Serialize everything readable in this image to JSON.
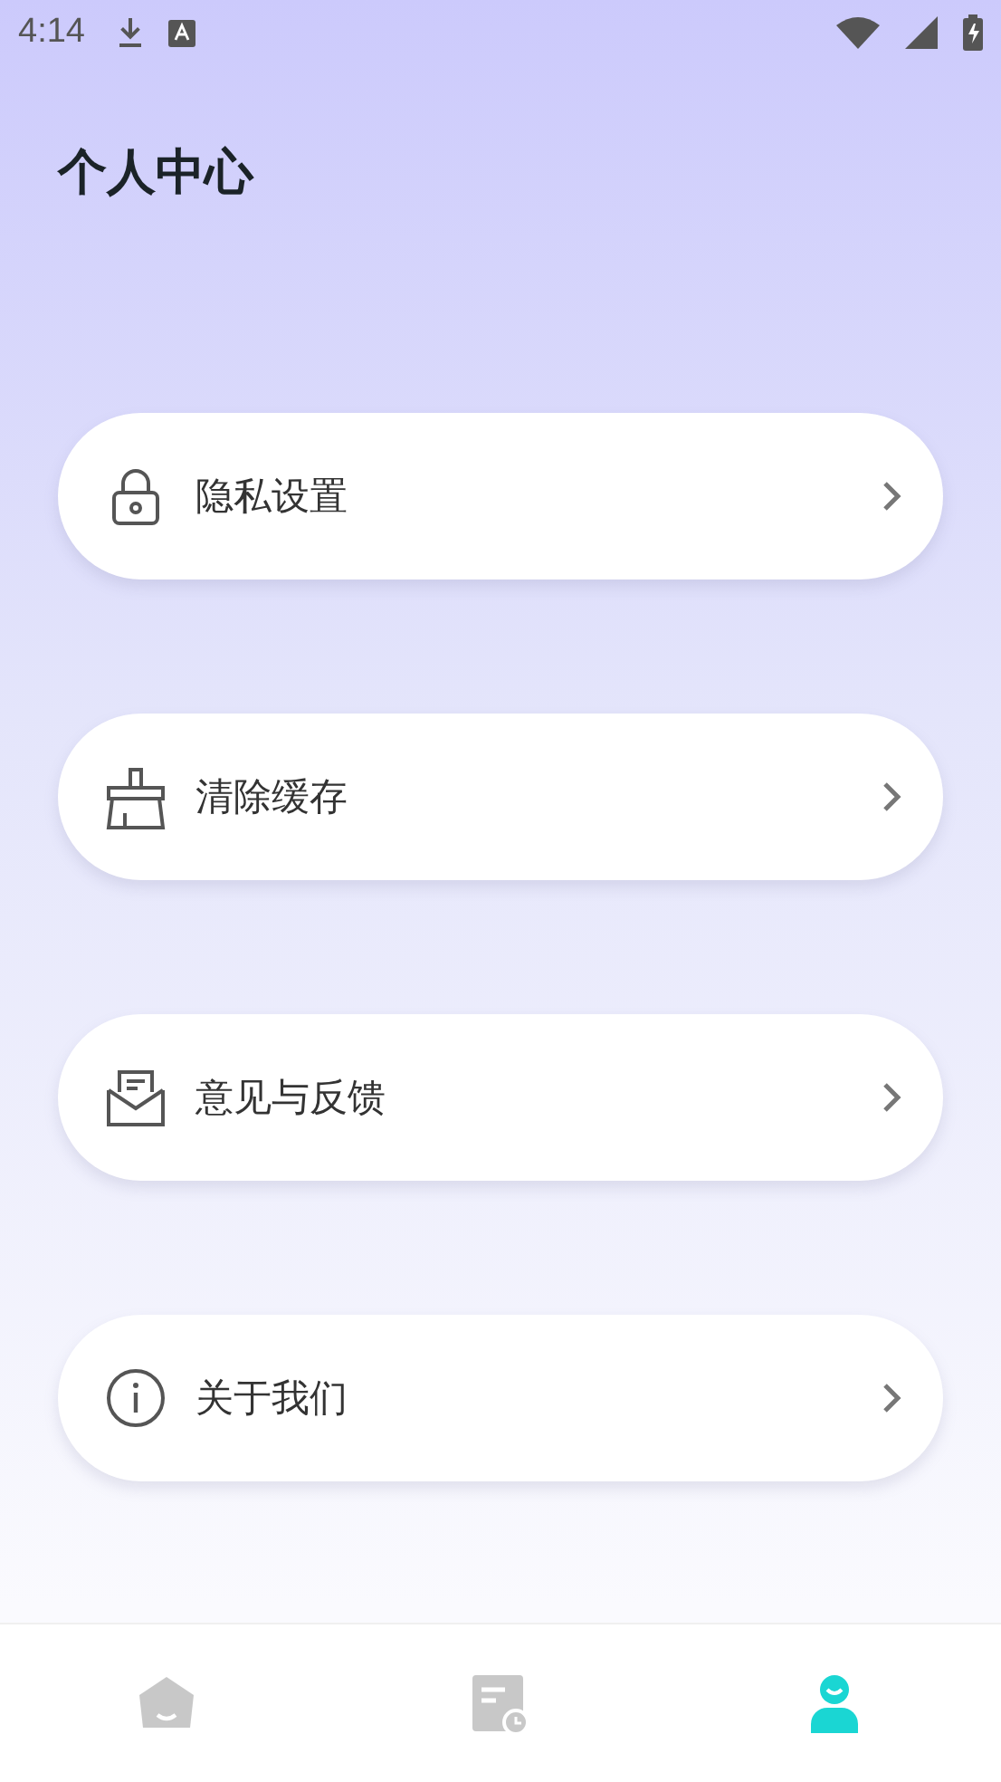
{
  "status_bar": {
    "time": "4:14"
  },
  "title": "个人中心",
  "menu": [
    {
      "kind": "lock",
      "label": "隐私设置"
    },
    {
      "kind": "broom",
      "label": "清除缓存"
    },
    {
      "kind": "mail",
      "label": "意见与反馈"
    },
    {
      "kind": "info",
      "label": "关于我们"
    }
  ],
  "nav": [
    {
      "kind": "home",
      "selected": false
    },
    {
      "kind": "record",
      "selected": false
    },
    {
      "kind": "person",
      "selected": true
    }
  ]
}
